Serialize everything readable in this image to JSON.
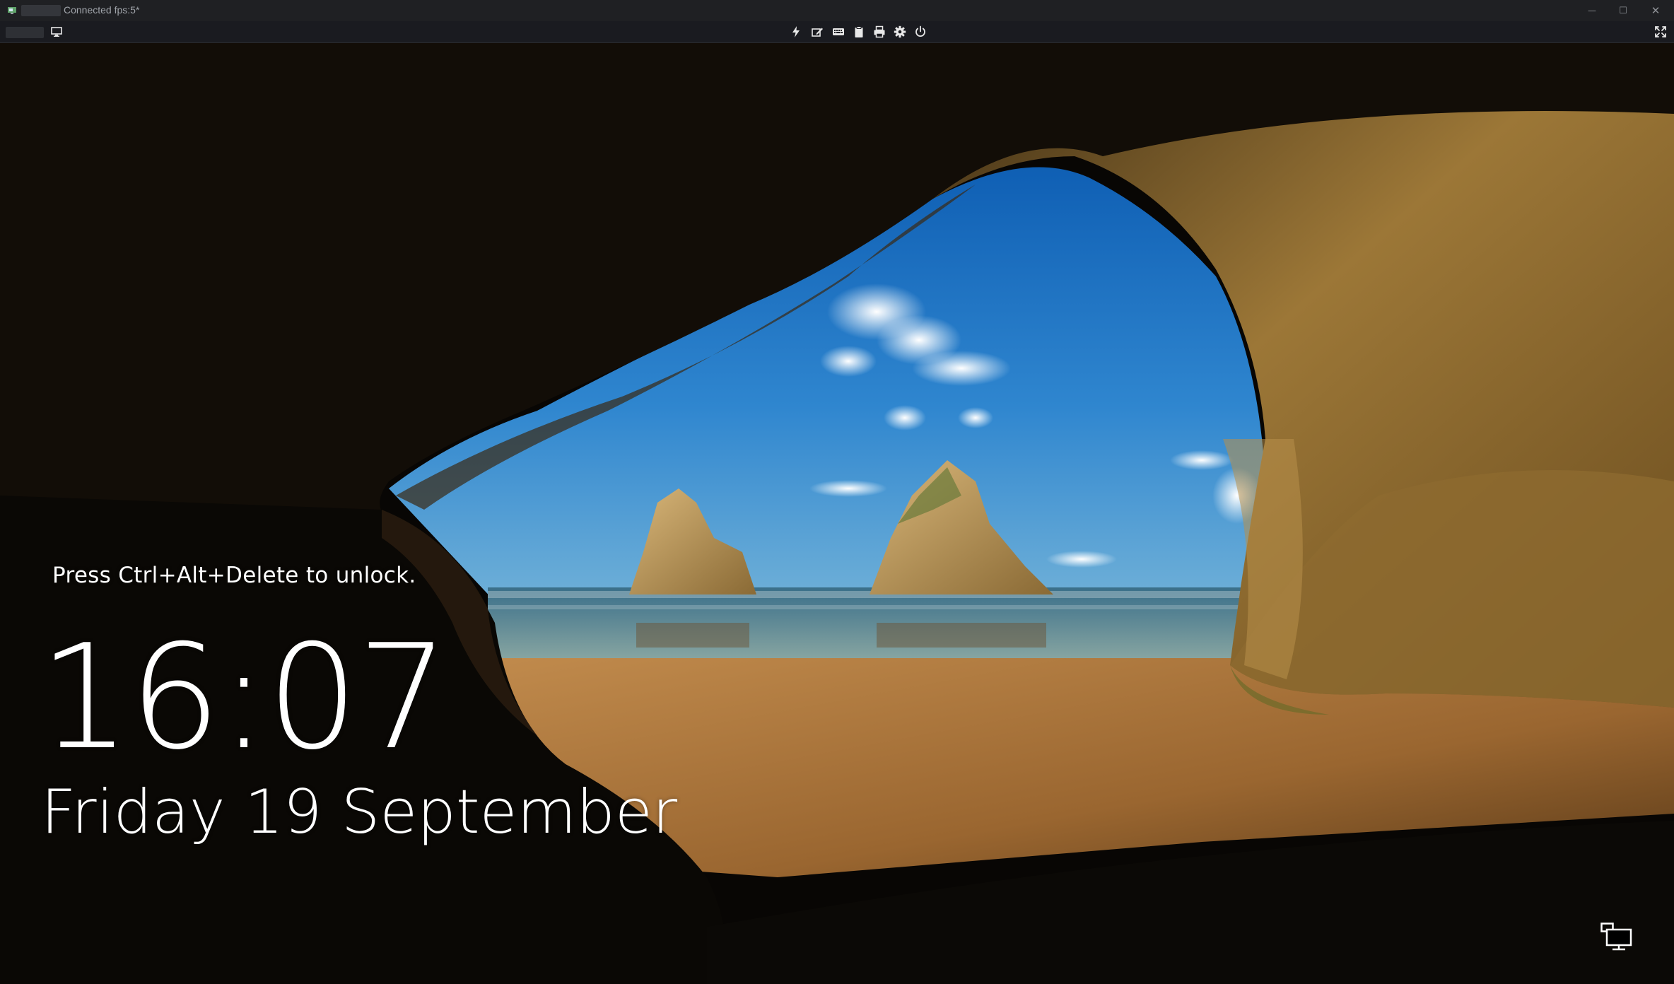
{
  "window": {
    "title_text": "Connected fps:5*",
    "controls": {
      "minimize_glyph": "—",
      "maximize_glyph": "☐",
      "close_glyph": "✕"
    }
  },
  "toolbar": {
    "left_icons": [
      "monitor-icon"
    ],
    "center_icons": [
      "lightning-icon",
      "edit-icon",
      "keyboard-icon",
      "clipboard-icon",
      "printer-icon",
      "gear-icon",
      "power-icon"
    ],
    "right_icons": [
      "fullscreen-icon"
    ]
  },
  "lock_screen": {
    "unlock_hint": "Press Ctrl+Alt+Delete to unlock.",
    "time": "16:07",
    "date": "Friday 19 September",
    "network_icon": "network-icon"
  },
  "colors": {
    "titlebar_bg": "#1f2023",
    "toolbar_bg": "#1a1b20",
    "sky": "#2f7cc6",
    "sand": "#b0773c",
    "rock": "#8f6a2e",
    "lock_text": "#ffffff"
  }
}
